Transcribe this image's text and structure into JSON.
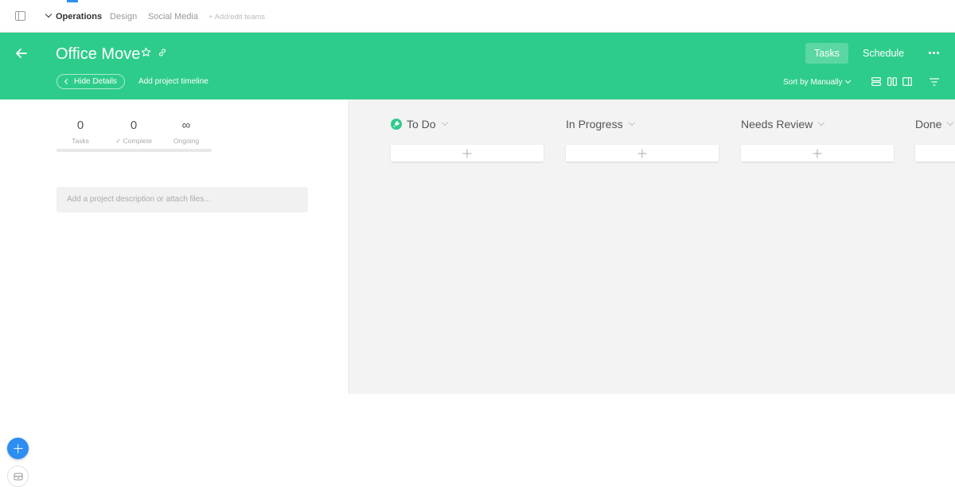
{
  "teams": {
    "items": [
      {
        "label": "Operations",
        "active": true
      },
      {
        "label": "Design",
        "active": false
      },
      {
        "label": "Social Media",
        "active": false
      }
    ],
    "add_label": "+ Add/edit teams"
  },
  "project": {
    "title": "Office Move",
    "hide_details_label": "Hide Details",
    "add_timeline_label": "Add project timeline",
    "accent_color": "#2ecc8a"
  },
  "views": {
    "tasks_label": "Tasks",
    "schedule_label": "Schedule"
  },
  "toolbar": {
    "sort_label": "Sort by Manually"
  },
  "details": {
    "stats": [
      {
        "value": "0",
        "label": "Tasks"
      },
      {
        "value": "0",
        "label": "✓ Complete"
      },
      {
        "value": "∞",
        "label": "Ongoing"
      }
    ],
    "progress_fraction": 0,
    "description_placeholder": "Add a project description or attach files..."
  },
  "board": {
    "columns": [
      {
        "title": "To Do",
        "pinned": true
      },
      {
        "title": "In Progress",
        "pinned": false
      },
      {
        "title": "Needs Review",
        "pinned": false
      },
      {
        "title": "Done",
        "pinned": false
      }
    ]
  }
}
